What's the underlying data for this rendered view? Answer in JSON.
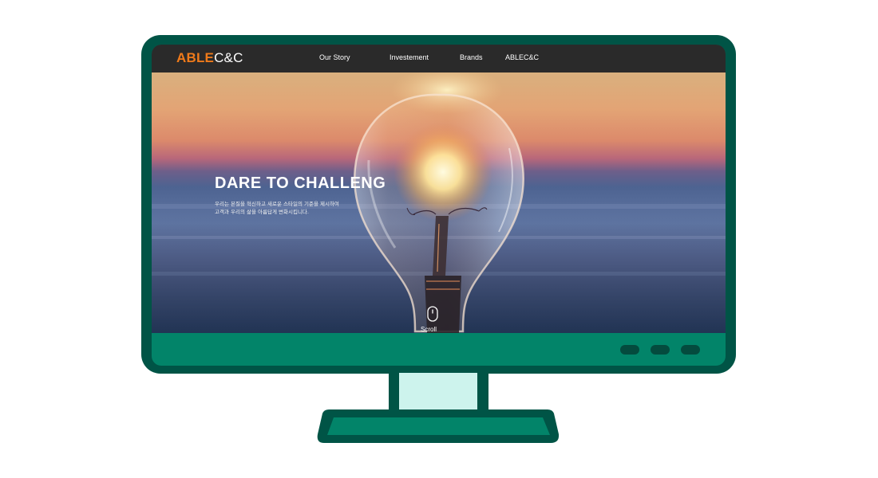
{
  "brand": {
    "primary": "ABLE",
    "secondary": "C&C",
    "primary_color": "#ef7a1a"
  },
  "nav": {
    "items": [
      {
        "label": "Our Story"
      },
      {
        "label": "Investement"
      },
      {
        "label": "Brands"
      },
      {
        "label": "ABLEC&C"
      }
    ]
  },
  "hero": {
    "title": "DARE TO CHALLENG",
    "subtitle_line1": "우리는 본질을 혁신하고 새로운 스타일의 기준을 제시하여",
    "subtitle_line2": "고객과 우리의 삶을 아름답게 변화시킵니다.",
    "scroll_label": "Scroll",
    "scroll_icon": "mouse-icon"
  },
  "colors": {
    "monitor_frame": "#005446",
    "monitor_bezel": "#028469",
    "stand_neck_inner": "#cdf3ed",
    "navbar_bg": "#2a2a2a"
  }
}
